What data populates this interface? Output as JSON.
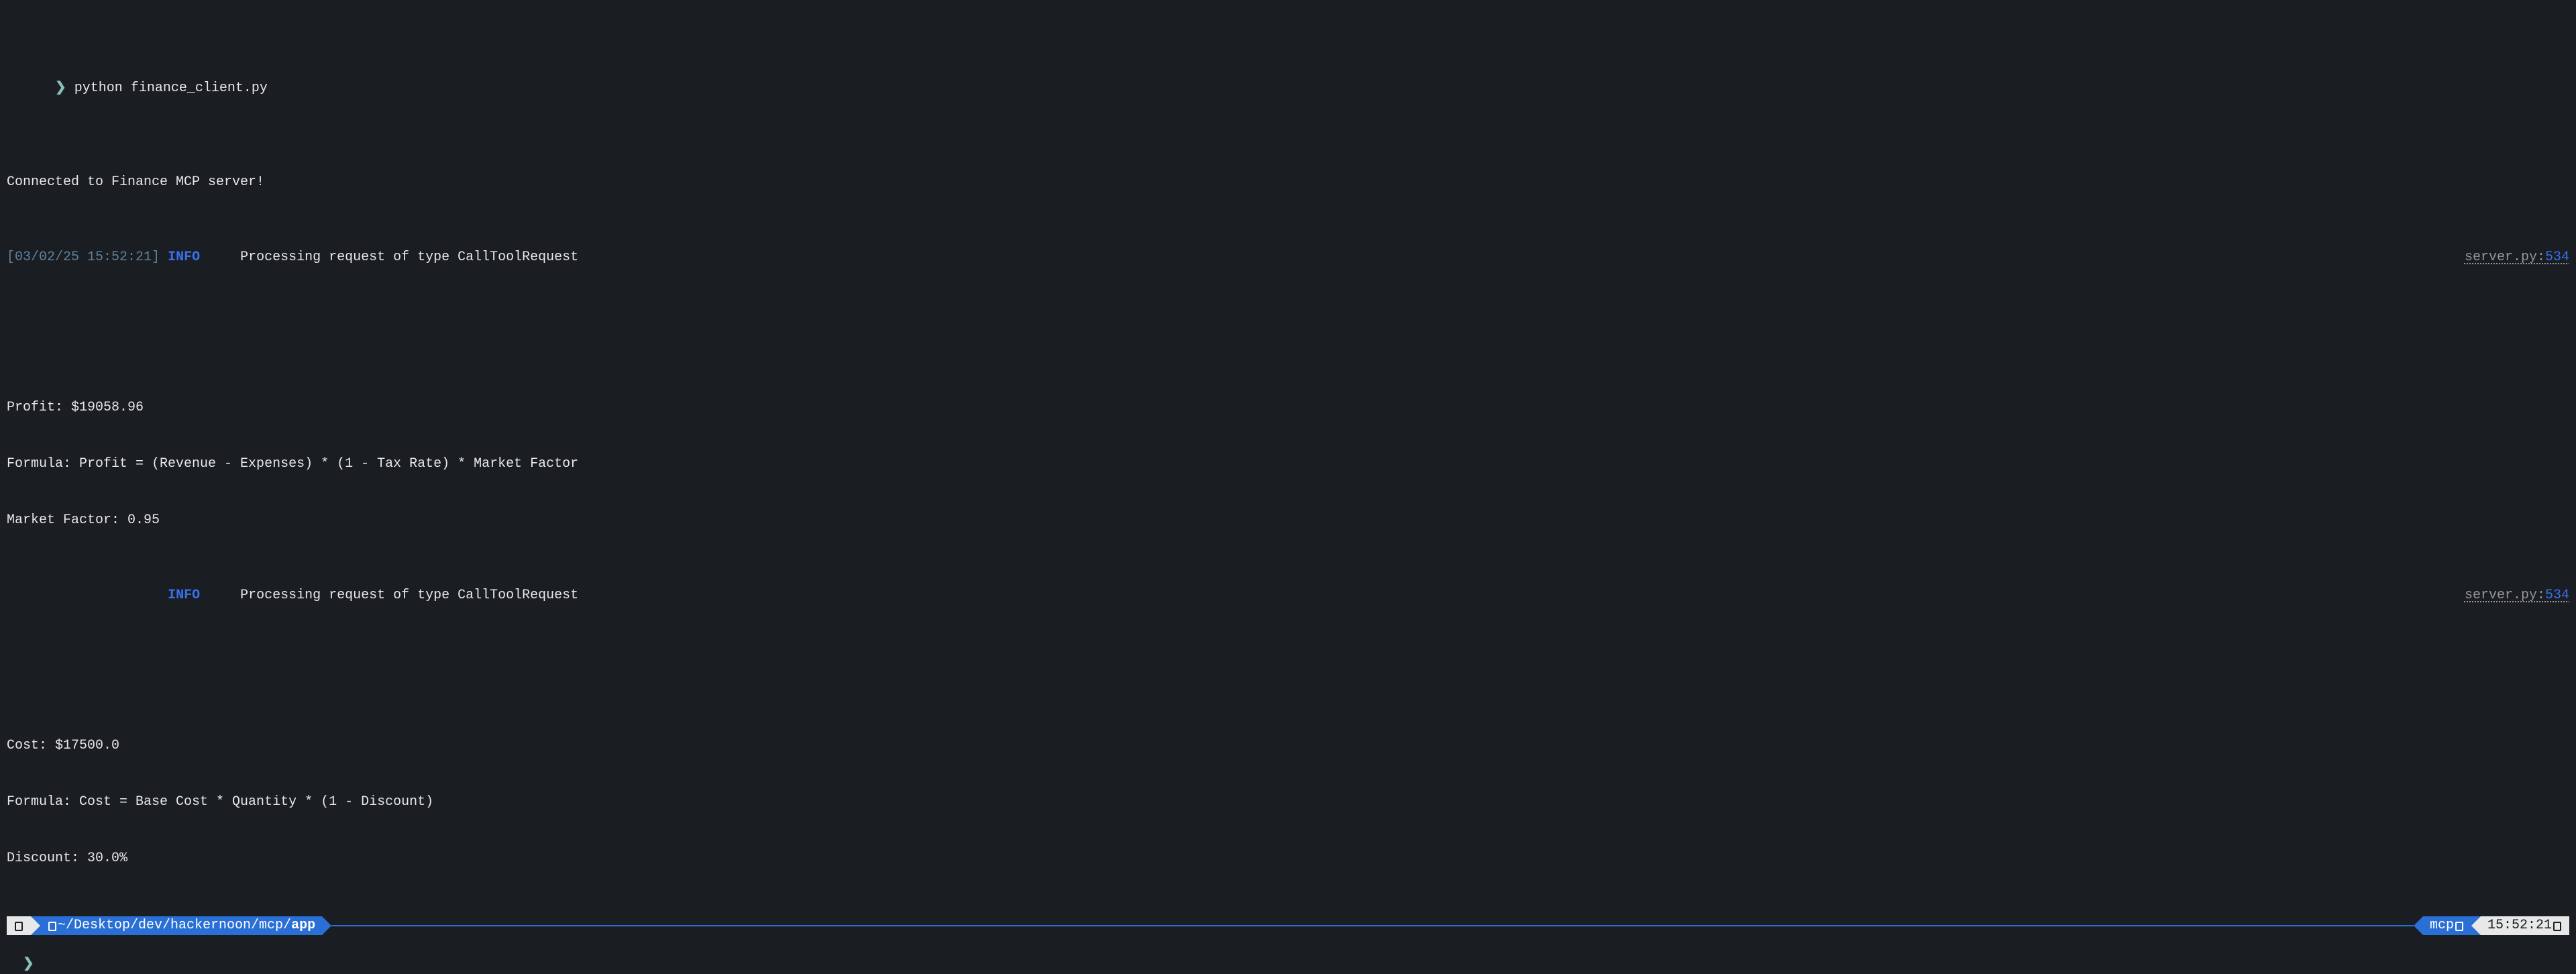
{
  "prompt": {
    "symbol": "❯",
    "command": "python finance_client.py"
  },
  "connected_line": "Connected to Finance MCP server!",
  "log1": {
    "timestamp": "[03/02/25 15:52:21]",
    "level": "INFO",
    "message": "Processing request of type CallToolRequest",
    "source_file": "server.py",
    "source_sep": ":",
    "source_line": "534"
  },
  "output1": {
    "profit": "Profit: $19058.96",
    "formula": "Formula: Profit = (Revenue - Expenses) * (1 - Tax Rate) * Market Factor",
    "market_factor": "Market Factor: 0.95"
  },
  "log2": {
    "level": "INFO",
    "message": "Processing request of type CallToolRequest",
    "source_file": "server.py",
    "source_sep": ":",
    "source_line": "534"
  },
  "output2": {
    "cost": "Cost: $17500.0",
    "formula": "Formula: Cost = Base Cost * Quantity * (1 - Discount)",
    "discount": "Discount: 30.0%"
  },
  "statusbar": {
    "path_prefix": " ~/Desktop/dev/hackernoon/mcp/",
    "path_bold": "app",
    "venv": "mcp",
    "clock": "15:52:21"
  },
  "new_prompt_symbol": "❯"
}
